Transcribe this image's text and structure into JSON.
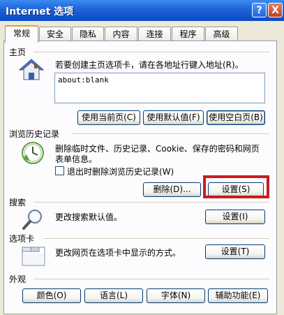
{
  "window": {
    "title": "Internet 选项",
    "help_button": "?",
    "close_button": "X"
  },
  "tabs": [
    {
      "label": "常规"
    },
    {
      "label": "安全"
    },
    {
      "label": "隐私"
    },
    {
      "label": "内容"
    },
    {
      "label": "连接"
    },
    {
      "label": "程序"
    },
    {
      "label": "高级"
    }
  ],
  "home": {
    "section_title": "主页",
    "description": "若要创建主页选项卡，请在各地址行键入地址(R)。",
    "address_value": "about:blank",
    "buttons": {
      "use_current": "使用当前页(C)",
      "use_default": "使用默认值(F)",
      "use_blank": "使用空白页(B)"
    }
  },
  "history": {
    "section_title": "浏览历史记录",
    "description_line1": "删除临时文件、历史记录、Cookie、保存的密码和网页",
    "description_line2": "表单信息。",
    "checkbox_label": "退出时删除浏览历史记录(W)",
    "delete_button": "删除(D)...",
    "settings_button": "设置(S)"
  },
  "search": {
    "section_title": "搜索",
    "description": "更改搜索默认值。",
    "settings_button": "设置(I)"
  },
  "tabs_section": {
    "section_title": "选项卡",
    "description": "更改网页在选项卡中显示的方式。",
    "settings_button": "设置(T)"
  },
  "appearance": {
    "section_title": "外观",
    "buttons": {
      "colors": "颜色(O)",
      "languages": "语言(L)",
      "fonts": "字体(N)",
      "accessibility": "辅助功能(E)"
    }
  },
  "colors": {
    "titlebar": "#1f62d8",
    "highlight": "#cc1b1f",
    "panel": "#fcfcfe",
    "window_bg": "#ece9d8"
  }
}
